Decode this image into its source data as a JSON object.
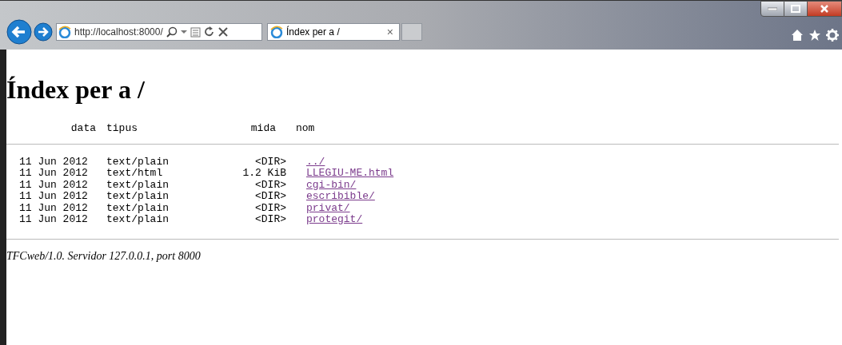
{
  "browser": {
    "address": "http://localhost:8000/",
    "tab": {
      "title": "Índex per a /",
      "close": "×"
    }
  },
  "page": {
    "heading": "Índex per a /",
    "columns": [
      "data",
      "tipus",
      "mida",
      "nom"
    ],
    "rows": [
      {
        "date": "11 Jun 2012",
        "type": "text/plain",
        "size": "<DIR>",
        "name": "../"
      },
      {
        "date": "11 Jun 2012",
        "type": "text/html",
        "size": "1.2 KiB",
        "name": "LLEGIU-ME.html"
      },
      {
        "date": "11 Jun 2012",
        "type": "text/plain",
        "size": "<DIR>",
        "name": "cgi-bin/"
      },
      {
        "date": "11 Jun 2012",
        "type": "text/plain",
        "size": "<DIR>",
        "name": "escribible/"
      },
      {
        "date": "11 Jun 2012",
        "type": "text/plain",
        "size": "<DIR>",
        "name": "privat/"
      },
      {
        "date": "11 Jun 2012",
        "type": "text/plain",
        "size": "<DIR>",
        "name": "protegit/"
      }
    ],
    "footer": "TFCweb/1.0. Servidor 127.0.0.1, port 8000"
  }
}
